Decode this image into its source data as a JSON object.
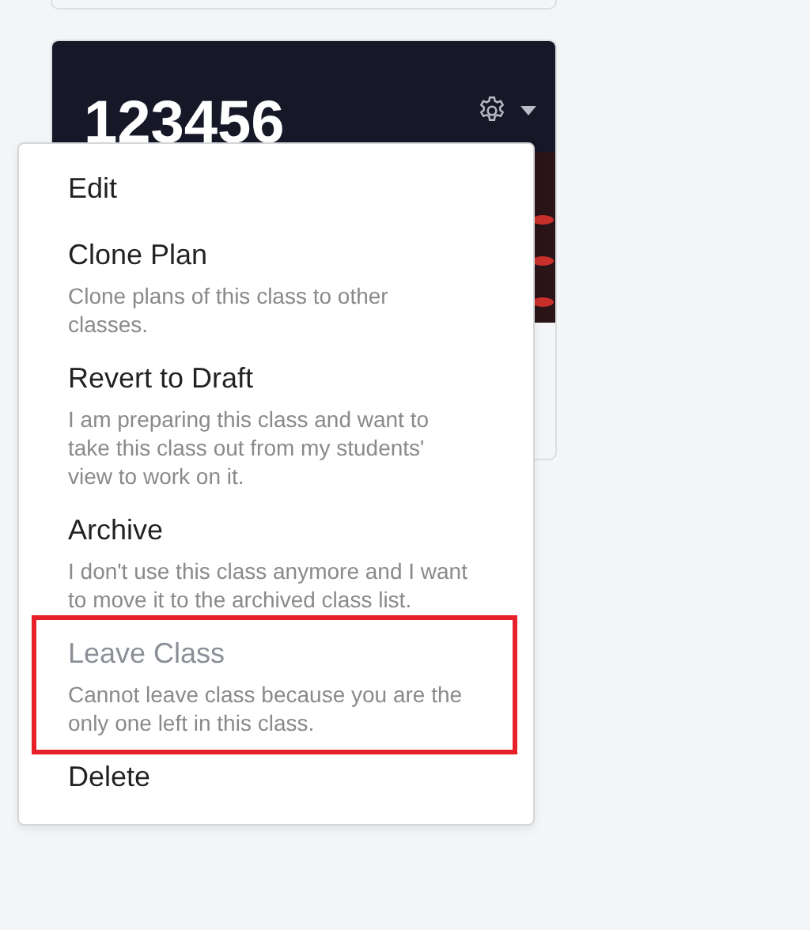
{
  "class_card": {
    "title": "123456"
  },
  "menu": {
    "items": [
      {
        "label": "Edit",
        "disabled": false,
        "highlighted": false
      },
      {
        "label": "Clone Plan",
        "description": "Clone plans of this class to other classes.",
        "disabled": false,
        "highlighted": false
      },
      {
        "label": "Revert to Draft",
        "description": "I am preparing this class and want to take this class out from my students' view to work on it.",
        "disabled": false,
        "highlighted": false
      },
      {
        "label": "Archive",
        "description": "I don't use this class anymore and I want to move it to the archived class list.",
        "disabled": false,
        "highlighted": false
      },
      {
        "label": "Leave Class",
        "description": "Cannot leave class because you are the only one left in this class.",
        "disabled": true,
        "highlighted": true
      },
      {
        "label": "Delete",
        "disabled": false,
        "highlighted": false
      }
    ]
  }
}
